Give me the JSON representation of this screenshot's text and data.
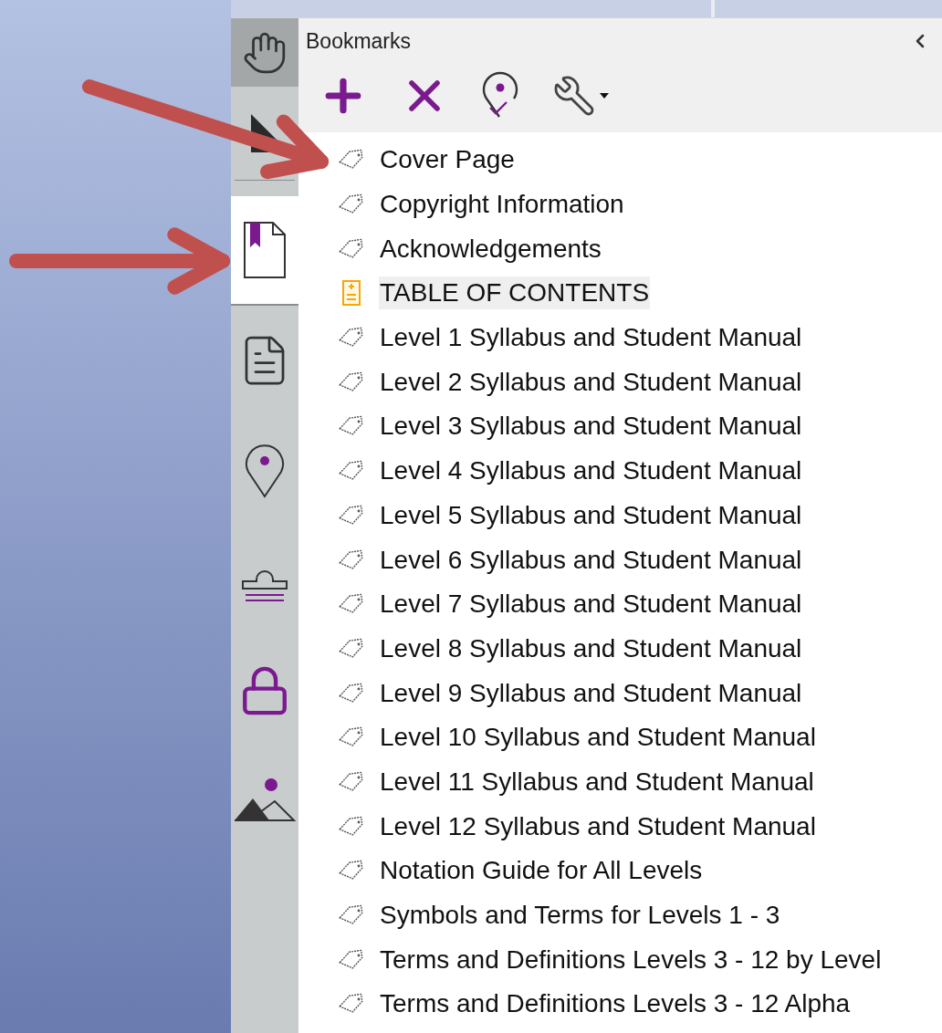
{
  "rail": [
    {
      "kind": "hand",
      "selected": true
    },
    {
      "kind": "select",
      "selected": false
    },
    {
      "kind": "bookmarks",
      "selected": true
    },
    {
      "kind": "pages",
      "selected": false
    },
    {
      "kind": "location",
      "selected": false
    },
    {
      "kind": "stamp",
      "selected": false
    },
    {
      "kind": "lock",
      "selected": false
    },
    {
      "kind": "image",
      "selected": false
    }
  ],
  "panel": {
    "title": "Bookmarks"
  },
  "bookmarks": [
    {
      "label": "Cover Page",
      "kind": "bookmark",
      "selected": false
    },
    {
      "label": "Copyright Information",
      "kind": "bookmark",
      "selected": false
    },
    {
      "label": "Acknowledgements",
      "kind": "bookmark",
      "selected": false
    },
    {
      "label": "TABLE OF CONTENTS",
      "kind": "toc",
      "selected": true
    },
    {
      "label": "Level 1 Syllabus and Student Manual",
      "kind": "bookmark",
      "selected": false
    },
    {
      "label": "Level 2 Syllabus and Student Manual",
      "kind": "bookmark",
      "selected": false
    },
    {
      "label": "Level 3 Syllabus and Student Manual",
      "kind": "bookmark",
      "selected": false
    },
    {
      "label": "Level 4 Syllabus and Student Manual",
      "kind": "bookmark",
      "selected": false
    },
    {
      "label": "Level 5 Syllabus and Student Manual",
      "kind": "bookmark",
      "selected": false
    },
    {
      "label": "Level 6 Syllabus and Student Manual",
      "kind": "bookmark",
      "selected": false
    },
    {
      "label": "Level 7 Syllabus and Student Manual",
      "kind": "bookmark",
      "selected": false
    },
    {
      "label": "Level 8 Syllabus and Student Manual",
      "kind": "bookmark",
      "selected": false
    },
    {
      "label": "Level 9 Syllabus and Student Manual",
      "kind": "bookmark",
      "selected": false
    },
    {
      "label": "Level 10 Syllabus and Student Manual",
      "kind": "bookmark",
      "selected": false
    },
    {
      "label": "Level 11 Syllabus and Student Manual",
      "kind": "bookmark",
      "selected": false
    },
    {
      "label": "Level 12 Syllabus and Student Manual",
      "kind": "bookmark",
      "selected": false
    },
    {
      "label": "Notation Guide for All Levels",
      "kind": "bookmark",
      "selected": false
    },
    {
      "label": "Symbols and Terms for Levels 1 - 3",
      "kind": "bookmark",
      "selected": false
    },
    {
      "label": "Terms and Definitions Levels 3 - 12 by Level",
      "kind": "bookmark",
      "selected": false
    },
    {
      "label": "Terms and Definitions Levels 3 - 12 Alpha",
      "kind": "bookmark",
      "selected": false
    }
  ]
}
